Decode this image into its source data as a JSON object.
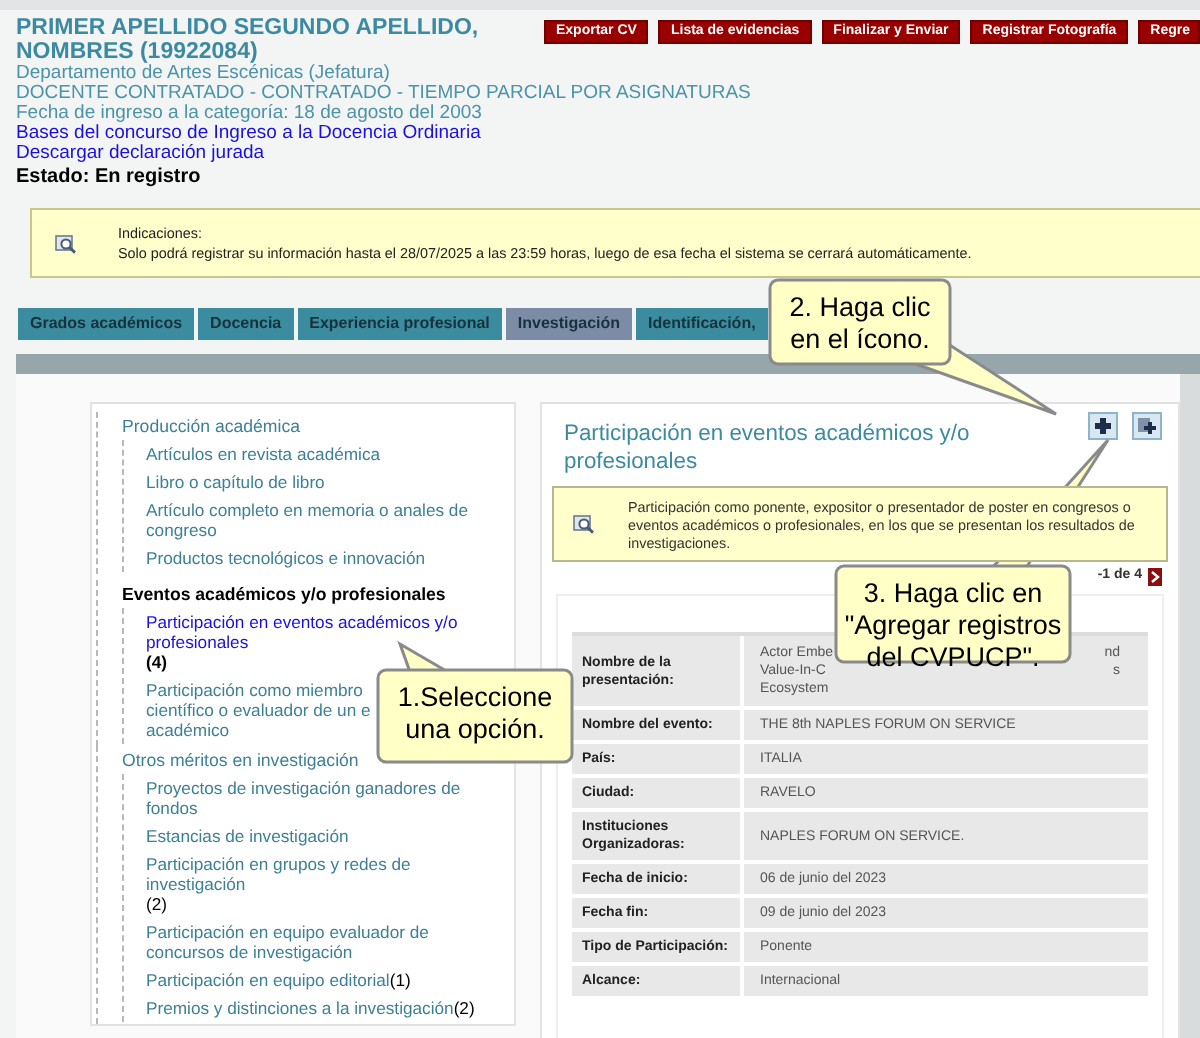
{
  "header": {
    "name": "PRIMER APELLIDO SEGUNDO APELLIDO, NOMBRES (19922084)",
    "lines": [
      "Departamento de Artes Escénicas (Jefatura)",
      "DOCENTE CONTRATADO - CONTRATADO - TIEMPO PARCIAL POR ASIGNATURAS",
      "Fecha de ingreso a la categoría: 18 de agosto del 2003"
    ],
    "links": [
      "Bases del concurso de Ingreso a la Docencia Ordinaria",
      "Descargar declaración jurada"
    ],
    "status": "Estado: En registro"
  },
  "actions": [
    "Exportar CV",
    "Lista de evidencias",
    "Finalizar y Enviar",
    "Registrar Fotografía",
    "Regre"
  ],
  "notice": {
    "title": "Indicaciones:",
    "text": "Solo podrá registrar su información hasta el 28/07/2025 a las 23:59 horas, luego de esa fecha el sistema se cerrará automáticamente."
  },
  "tabs": [
    {
      "label": "Grados académicos",
      "selected": false
    },
    {
      "label": "Docencia",
      "selected": false
    },
    {
      "label": "Experiencia profesional",
      "selected": false
    },
    {
      "label": "Investigación",
      "selected": true
    },
    {
      "label": "Identificación,",
      "selected": false
    }
  ],
  "tree": [
    {
      "label": "Producción académica",
      "selected": false,
      "children": [
        {
          "label": "Artículos en revista académica",
          "selected": false
        },
        {
          "label": "Libro o capítulo de libro",
          "selected": false
        },
        {
          "label": "Artículo completo en memoria o anales de congreso",
          "selected": false
        },
        {
          "label": "Productos tecnológicos e innovación",
          "selected": false
        }
      ]
    },
    {
      "label": "Eventos académicos y/o profesionales",
      "selected": true,
      "children": [
        {
          "label": "Participación en eventos académicos y/o profesionales",
          "count": "(4)",
          "selected": true
        },
        {
          "lines": [
            "Participación como miembro",
            "científico o evaluador de un e",
            "académico"
          ],
          "selected": false
        }
      ]
    },
    {
      "label": "Otros méritos en investigación",
      "selected": false,
      "children": [
        {
          "label": "Proyectos de investigación ganadores de fondos",
          "selected": false
        },
        {
          "label": "Estancias de investigación",
          "selected": false
        },
        {
          "label": "Participación en grupos y redes de investigación",
          "count": "(2)",
          "selected": false
        },
        {
          "label": "Participación en equipo evaluador de concursos de investigación",
          "selected": false
        },
        {
          "label": "Participación en equipo editorial",
          "inline_count": "(1)",
          "selected": false
        },
        {
          "label": "Premios y distinciones a la investigación",
          "inline_count": "(2)",
          "selected": false
        }
      ]
    }
  ],
  "section": {
    "title": "Participación en eventos académicos y/o profesionales",
    "description": "Participación como ponente, expositor o presentador de poster en congresos o eventos académicos o profesionales, en los que se presentan los resultados de investigaciones.",
    "pager": "-1 de 4",
    "record": [
      {
        "label": "Nombre de la presentación:",
        "fragments": [
          [
            "Actor Embe",
            "nd"
          ],
          [
            "Value-In-C",
            "s"
          ],
          [
            "Ecosystem"
          ]
        ]
      },
      {
        "label": "Nombre del evento:",
        "value": "THE 8th NAPLES FORUM ON SERVICE"
      },
      {
        "label": "País:",
        "value": "ITALIA"
      },
      {
        "label": "Ciudad:",
        "value": "RAVELO"
      },
      {
        "label": "Instituciones Organizadoras:",
        "value": "NAPLES FORUM ON SERVICE."
      },
      {
        "label": "Fecha de inicio:",
        "value": "06 de junio del 2023"
      },
      {
        "label": "Fecha fin:",
        "value": "09 de junio del 2023"
      },
      {
        "label": "Tipo de Participación:",
        "value": "Ponente"
      },
      {
        "label": "Alcance:",
        "value": "Internacional"
      }
    ]
  },
  "callouts": [
    "1.Seleccione una opción.",
    "2. Haga clic en el ícono.",
    "3. Haga clic en \"Agregar registros del CVPUCP\"."
  ]
}
